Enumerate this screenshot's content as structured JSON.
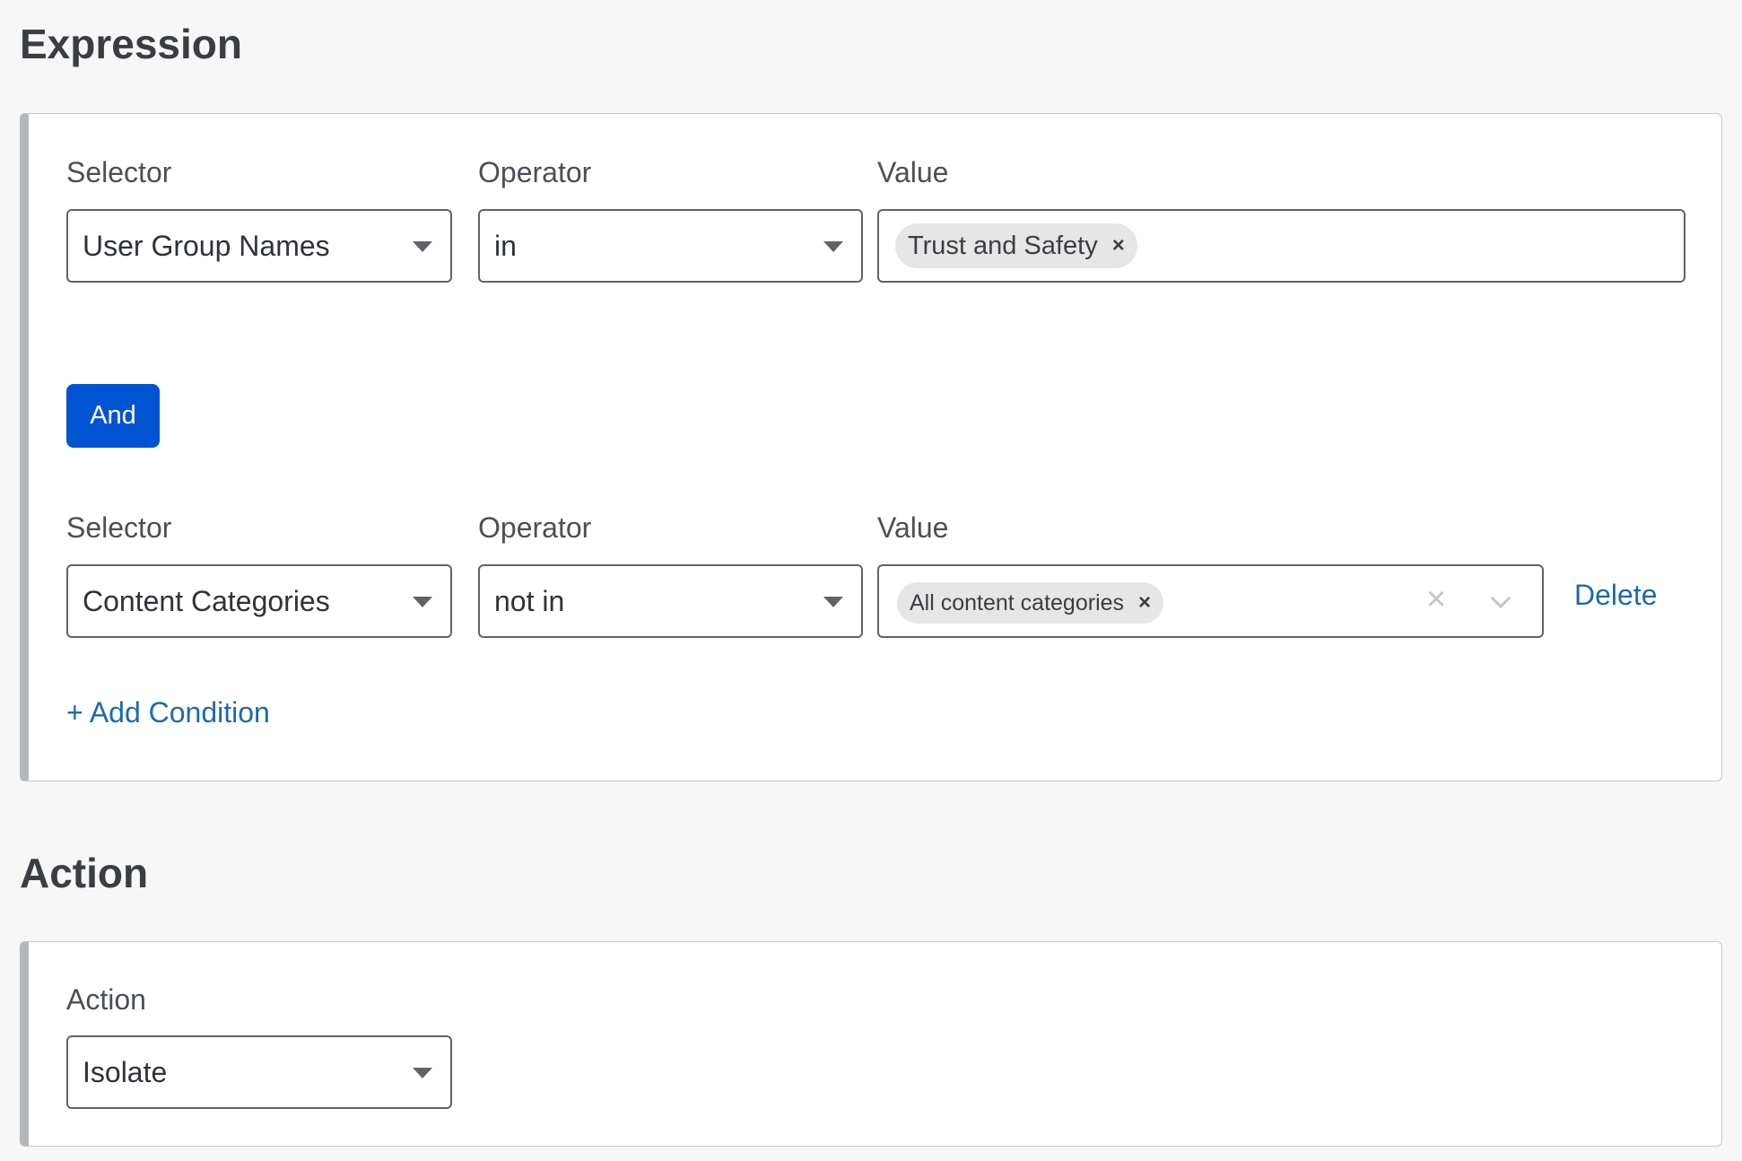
{
  "expression": {
    "title": "Expression",
    "conditions": [
      {
        "selector_label": "Selector",
        "selector_value": "User Group Names",
        "operator_label": "Operator",
        "operator_value": "in",
        "value_label": "Value",
        "value_chips": [
          "Trust and Safety"
        ]
      },
      {
        "selector_label": "Selector",
        "selector_value": "Content Categories",
        "operator_label": "Operator",
        "operator_value": "not in",
        "value_label": "Value",
        "value_chips": [
          "All content categories"
        ],
        "delete_label": "Delete"
      }
    ],
    "and_label": "And",
    "add_condition_label": "+ Add Condition"
  },
  "action": {
    "title": "Action",
    "label": "Action",
    "value": "Isolate"
  },
  "colors": {
    "accent": "#0054d1",
    "link": "#1f6aa8",
    "background": "#f7f7f7"
  }
}
